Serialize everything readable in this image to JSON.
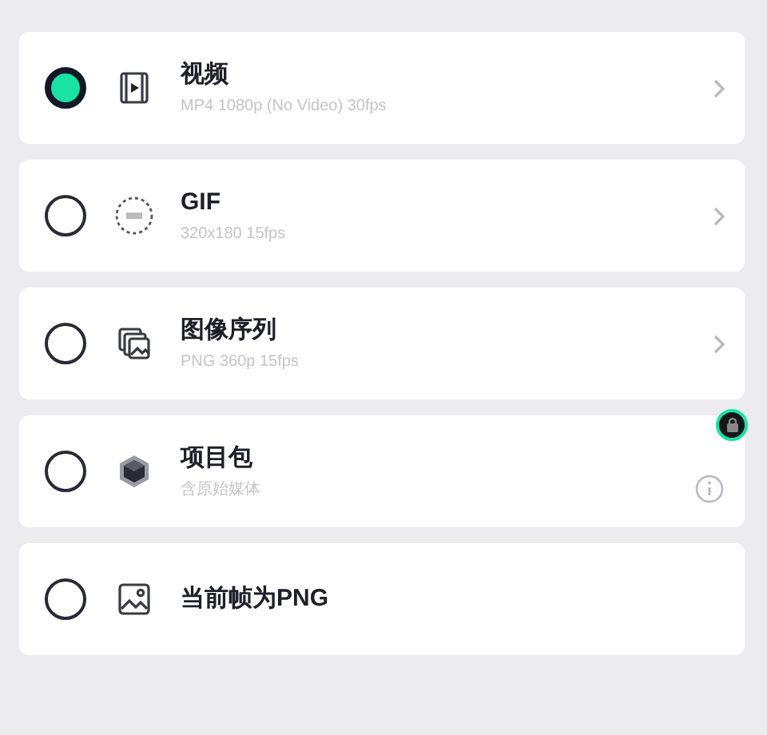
{
  "options": [
    {
      "kind": "submenu",
      "title": "视频",
      "subtitle": "MP4 1080p (No Video) 30fps",
      "selected": true
    },
    {
      "kind": "submenu",
      "title": "GIF",
      "subtitle": "320x180 15fps",
      "selected": false
    },
    {
      "kind": "submenu",
      "title": "图像序列",
      "subtitle": "PNG 360p 15fps",
      "selected": false
    },
    {
      "kind": "info",
      "title": "项目包",
      "subtitle": "含原始媒体",
      "selected": false,
      "locked": true
    },
    {
      "kind": "plain",
      "title": "当前帧为PNG",
      "selected": false
    }
  ]
}
